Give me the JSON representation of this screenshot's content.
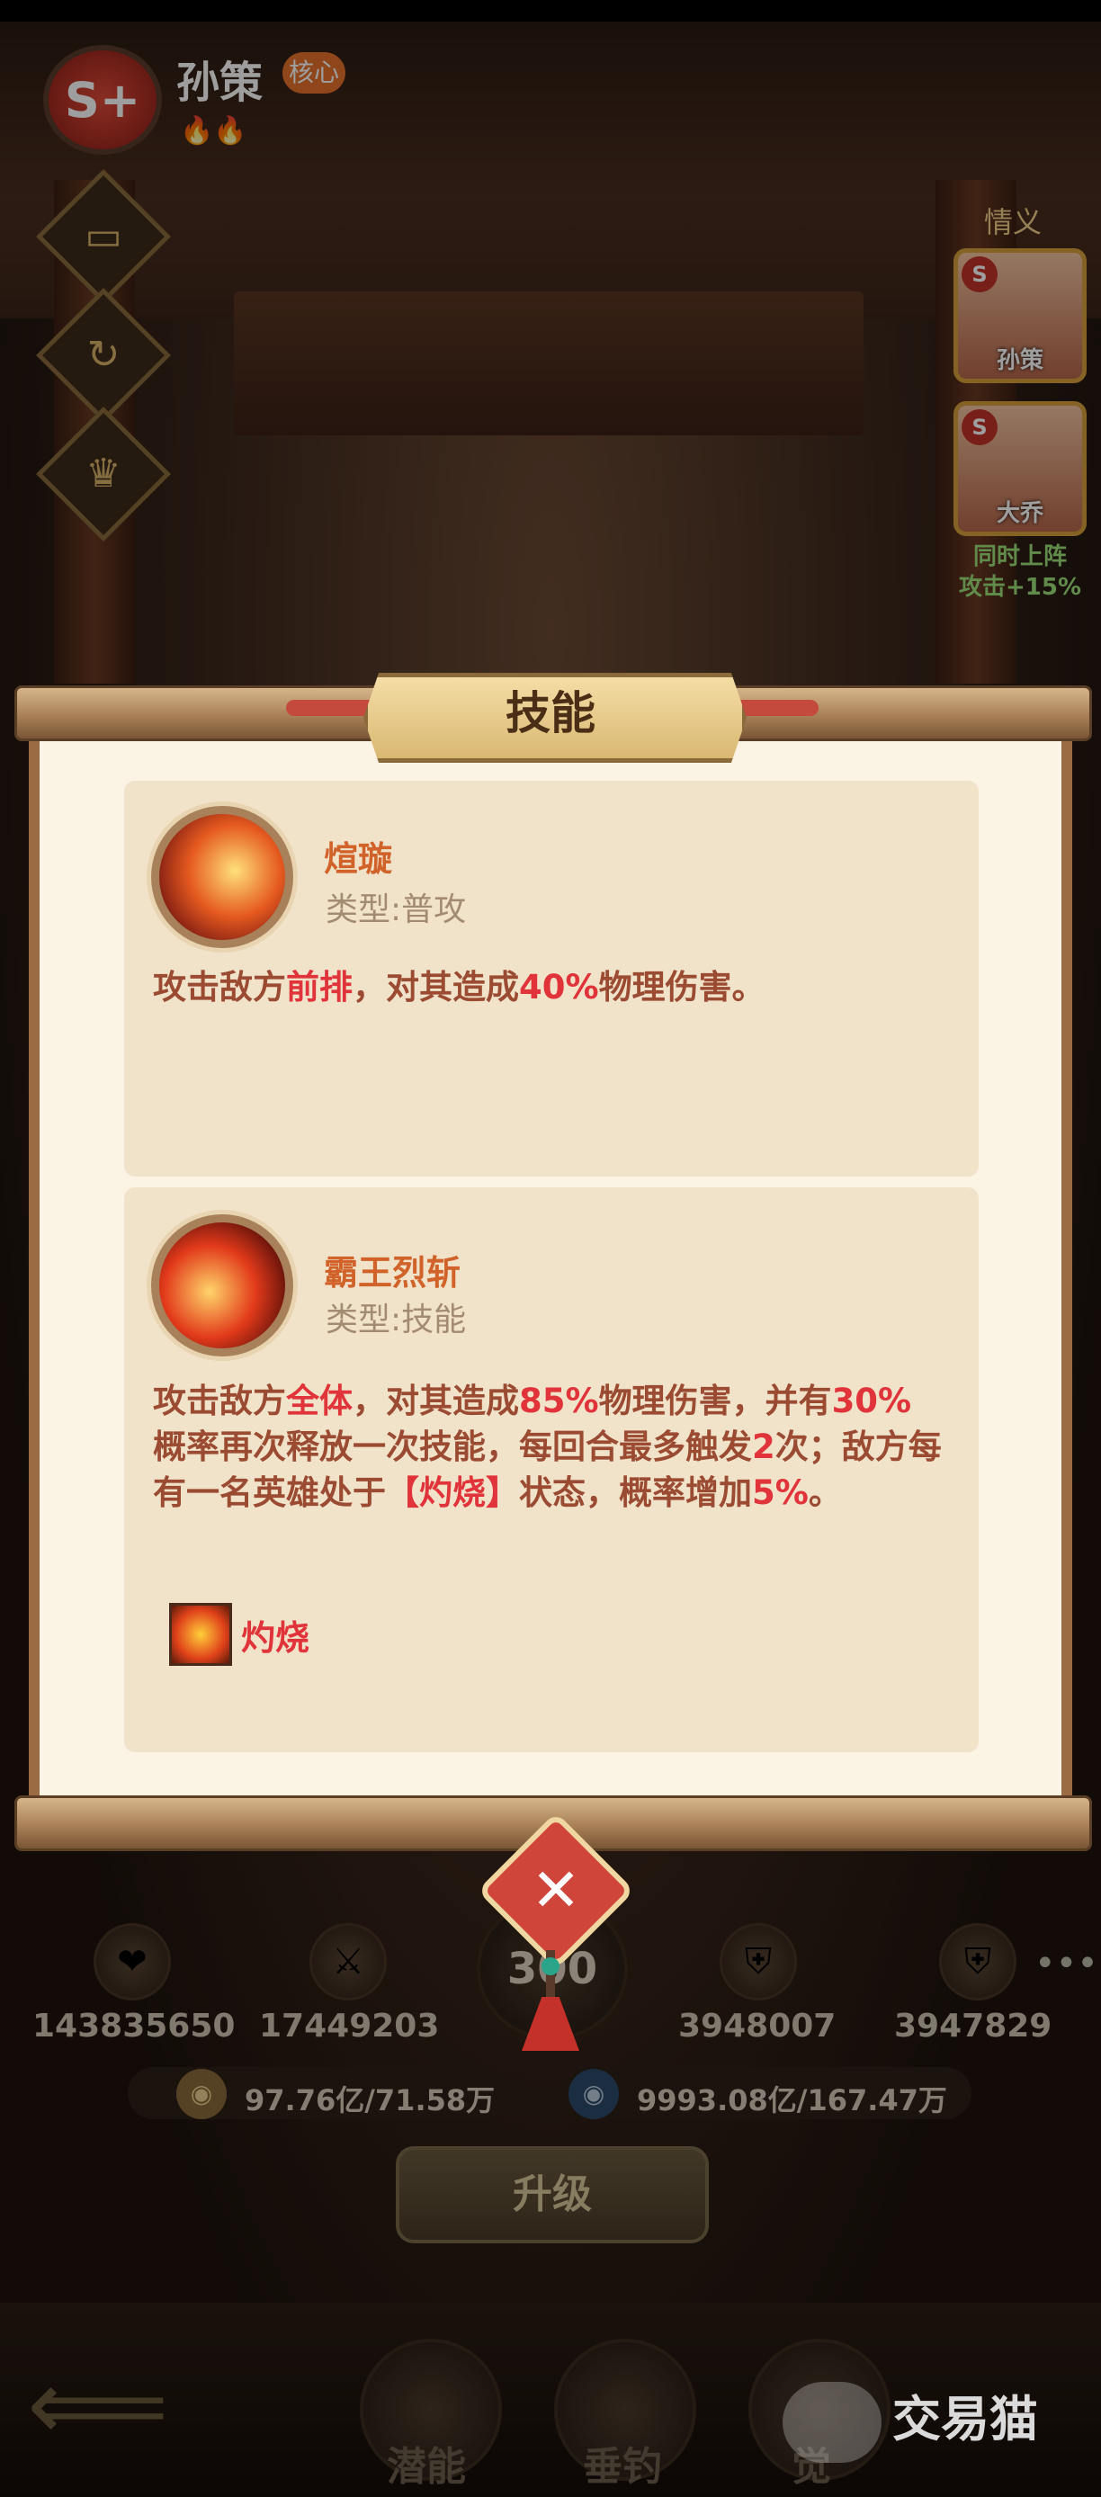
{
  "header": {
    "rank": "S+",
    "hero_name": "孙策",
    "core_tag": "核心",
    "flames": "🔥🔥"
  },
  "side_buttons": [
    "panel-icon",
    "refresh-icon",
    "helmet-icon"
  ],
  "bond": {
    "title": "情义",
    "cards": [
      {
        "name": "孙策",
        "rank": "S"
      },
      {
        "name": "大乔",
        "rank": "S"
      }
    ],
    "note_line1": "同时上阵",
    "note_line2": "攻击+15%"
  },
  "panel": {
    "title": "技能",
    "skills": [
      {
        "name": "煊璇",
        "type": "类型:普攻",
        "desc_parts": [
          "攻击敌方",
          "前排",
          "，对其造成",
          "40%",
          "物理伤害。"
        ]
      },
      {
        "name": "霸王烈斩",
        "type": "类型:技能",
        "desc_parts": [
          "攻击敌方",
          "全体",
          "，对其造成",
          "85%",
          "物理伤害，并有",
          "30%",
          "概率再次释放一次技能，每回合最多触发",
          "2",
          "次；敌方每有一名英雄处于",
          "【灼烧】",
          "状态，概率增加",
          "5%",
          "。"
        ],
        "status_label": "灼烧"
      }
    ]
  },
  "stats": {
    "hp": "143835650",
    "attack": "17449203",
    "center": "300",
    "def1": "3948007",
    "def2": "3947829"
  },
  "resources": {
    "gold": "97.76亿/71.58万",
    "exp": "9993.08亿/167.47万"
  },
  "upgrade_label": "升级",
  "nav": {
    "potential": "潜能",
    "fishing": "垂钓",
    "third": "觉"
  },
  "watermark": "交易猫",
  "colors": {
    "accent_red": "#e0333a",
    "skill_name": "#d1622a",
    "panel_bg": "#fbf3e3"
  }
}
